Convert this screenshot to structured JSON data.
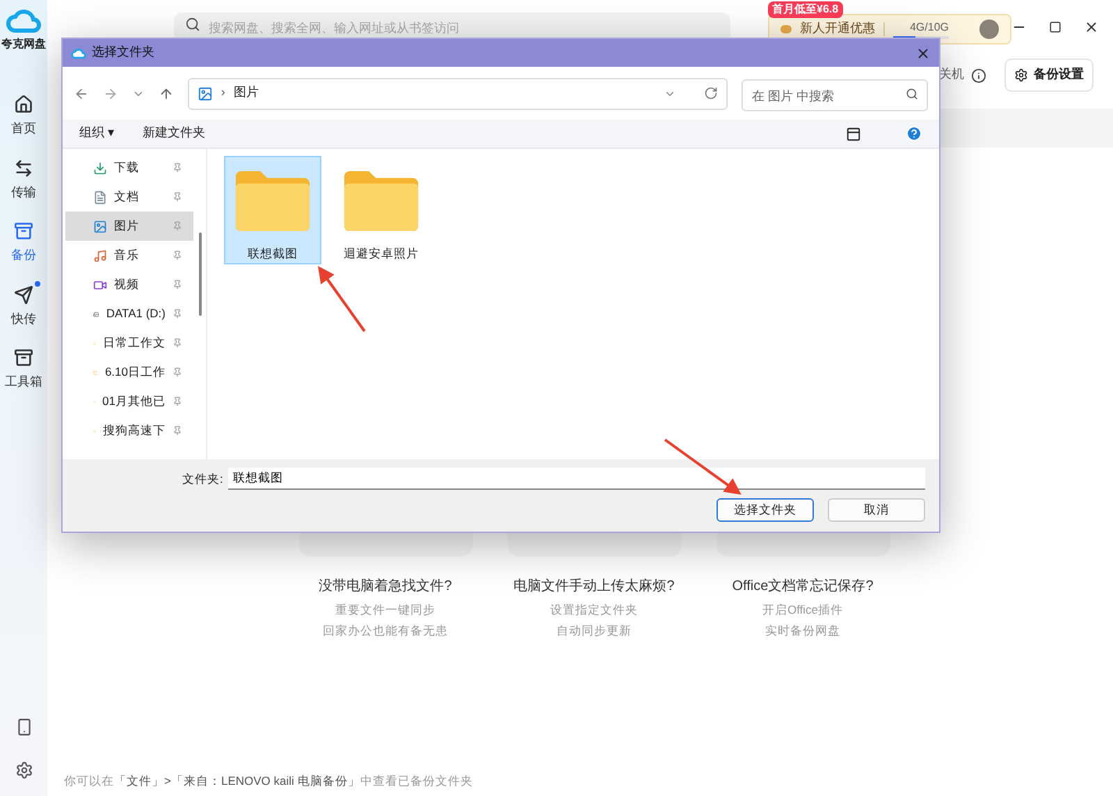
{
  "app": {
    "name": "夸克网盘",
    "nav": [
      {
        "label": "首页",
        "kind": "home",
        "selected": false,
        "dot": false
      },
      {
        "label": "传输",
        "kind": "transfer",
        "selected": false,
        "dot": false
      },
      {
        "label": "备份",
        "kind": "backup",
        "selected": true,
        "dot": false
      },
      {
        "label": "快传",
        "kind": "send",
        "selected": false,
        "dot": true
      },
      {
        "label": "工具箱",
        "kind": "toolbox",
        "selected": false,
        "dot": false
      }
    ]
  },
  "search": {
    "placeholder": "搜索网盘、搜索全网、输入网址或从书签访问"
  },
  "promo": {
    "badge": "首月低至¥6.8",
    "label": "新人开通优惠",
    "storage": "4G/10G",
    "level": 0.4
  },
  "backup_header": {
    "partial_text": "关机",
    "settings_button": "备份设置"
  },
  "features": [
    {
      "title": "没带电脑着急找文件?",
      "lines": [
        "重要文件一键同步",
        "回家办公也能有备无患"
      ]
    },
    {
      "title": "电脑文件手动上传太麻烦?",
      "lines": [
        "设置指定文件夹",
        "自动同步更新"
      ]
    },
    {
      "title": "Office文档常忘记保存?",
      "lines": [
        "开启Office插件",
        "实时备份网盘"
      ]
    }
  ],
  "footer": {
    "prefix": "你可以在",
    "link": "「文件」>「来自：LENOVO kaili  电脑备份」",
    "suffix": "中查看已备份文件夹"
  },
  "dialog": {
    "title": "选择文件夹",
    "address": {
      "separator": "›",
      "location": "图片"
    },
    "search": {
      "placeholder": "在 图片 中搜索"
    },
    "toolbar": {
      "organize": "组织 ▾",
      "new_folder": "新建文件夹"
    },
    "nav_pane": [
      {
        "label": "下载",
        "kind": "download",
        "selected": false
      },
      {
        "label": "文档",
        "kind": "document",
        "selected": false
      },
      {
        "label": "图片",
        "kind": "picture",
        "selected": true
      },
      {
        "label": "音乐",
        "kind": "music",
        "selected": false
      },
      {
        "label": "视频",
        "kind": "video",
        "selected": false
      },
      {
        "label": "DATA1 (D:)",
        "kind": "drive",
        "selected": false
      },
      {
        "label": "日常工作文",
        "kind": "folder",
        "selected": false
      },
      {
        "label": "6.10日工作",
        "kind": "folder",
        "selected": false
      },
      {
        "label": "01月其他已",
        "kind": "folder",
        "selected": false
      },
      {
        "label": "搜狗高速下",
        "kind": "folder",
        "selected": false
      }
    ],
    "folders": [
      {
        "name": "联想截图",
        "selected": true
      },
      {
        "name": "迴避安卓照片",
        "selected": false
      }
    ],
    "folder_field": {
      "label": "文件夹:",
      "value": "联想截图"
    },
    "buttons": [
      {
        "label": "选择文件夹",
        "kind": "primary"
      },
      {
        "label": "取消",
        "kind": "secondary"
      }
    ]
  }
}
